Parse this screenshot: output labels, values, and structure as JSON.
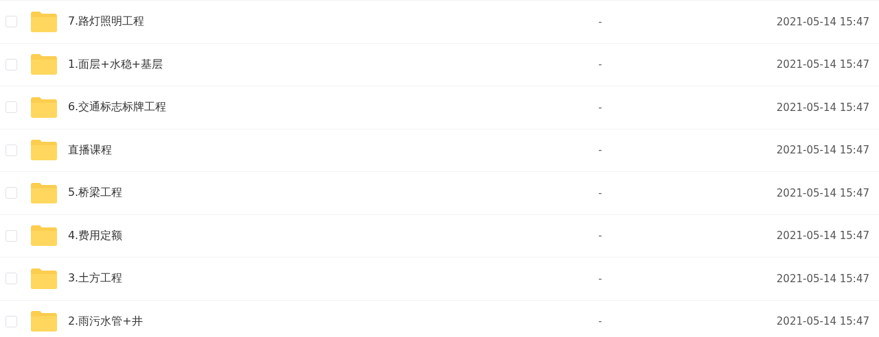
{
  "files": [
    {
      "name": "7.路灯照明工程",
      "size": "-",
      "modified": "2021-05-14 15:47",
      "checked": false
    },
    {
      "name": "1.面层+水稳+基层",
      "size": "-",
      "modified": "2021-05-14 15:47",
      "checked": false
    },
    {
      "name": "6.交通标志标牌工程",
      "size": "-",
      "modified": "2021-05-14 15:47",
      "checked": false
    },
    {
      "name": "直播课程",
      "size": "-",
      "modified": "2021-05-14 15:47",
      "checked": false
    },
    {
      "name": "5.桥梁工程",
      "size": "-",
      "modified": "2021-05-14 15:47",
      "checked": false
    },
    {
      "name": "4.费用定额",
      "size": "-",
      "modified": "2021-05-14 15:47",
      "checked": false
    },
    {
      "name": "3.土方工程",
      "size": "-",
      "modified": "2021-05-14 15:47",
      "checked": false
    },
    {
      "name": "2.雨污水管+井",
      "size": "-",
      "modified": "2021-05-14 15:47",
      "checked": false
    }
  ]
}
